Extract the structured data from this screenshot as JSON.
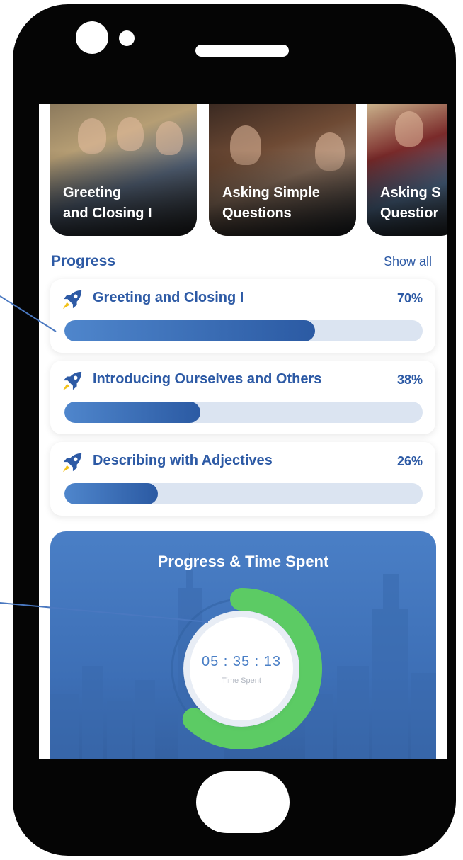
{
  "lesson_cards": [
    {
      "title": "Greeting\nand Closing I"
    },
    {
      "title": "Asking Simple\nQuestions"
    },
    {
      "title": "Asking S\nQuestior"
    }
  ],
  "progress": {
    "title": "Progress",
    "show_all": "Show all",
    "items": [
      {
        "title": "Greeting and Closing I",
        "percent_label": "70%",
        "percent": 70
      },
      {
        "title": "Introducing Ourselves and Others",
        "percent_label": "38%",
        "percent": 38
      },
      {
        "title": "Describing with Adjectives",
        "percent_label": "26%",
        "percent": 26
      }
    ]
  },
  "time_card": {
    "title": "Progress & Time Spent",
    "time": "05 : 35 : 13",
    "time_label": "Time Spent",
    "ring_progress": 0.62
  },
  "colors": {
    "accent": "#2d5aa5",
    "ring": "#5ccb64",
    "track": "#dbe4f1"
  }
}
